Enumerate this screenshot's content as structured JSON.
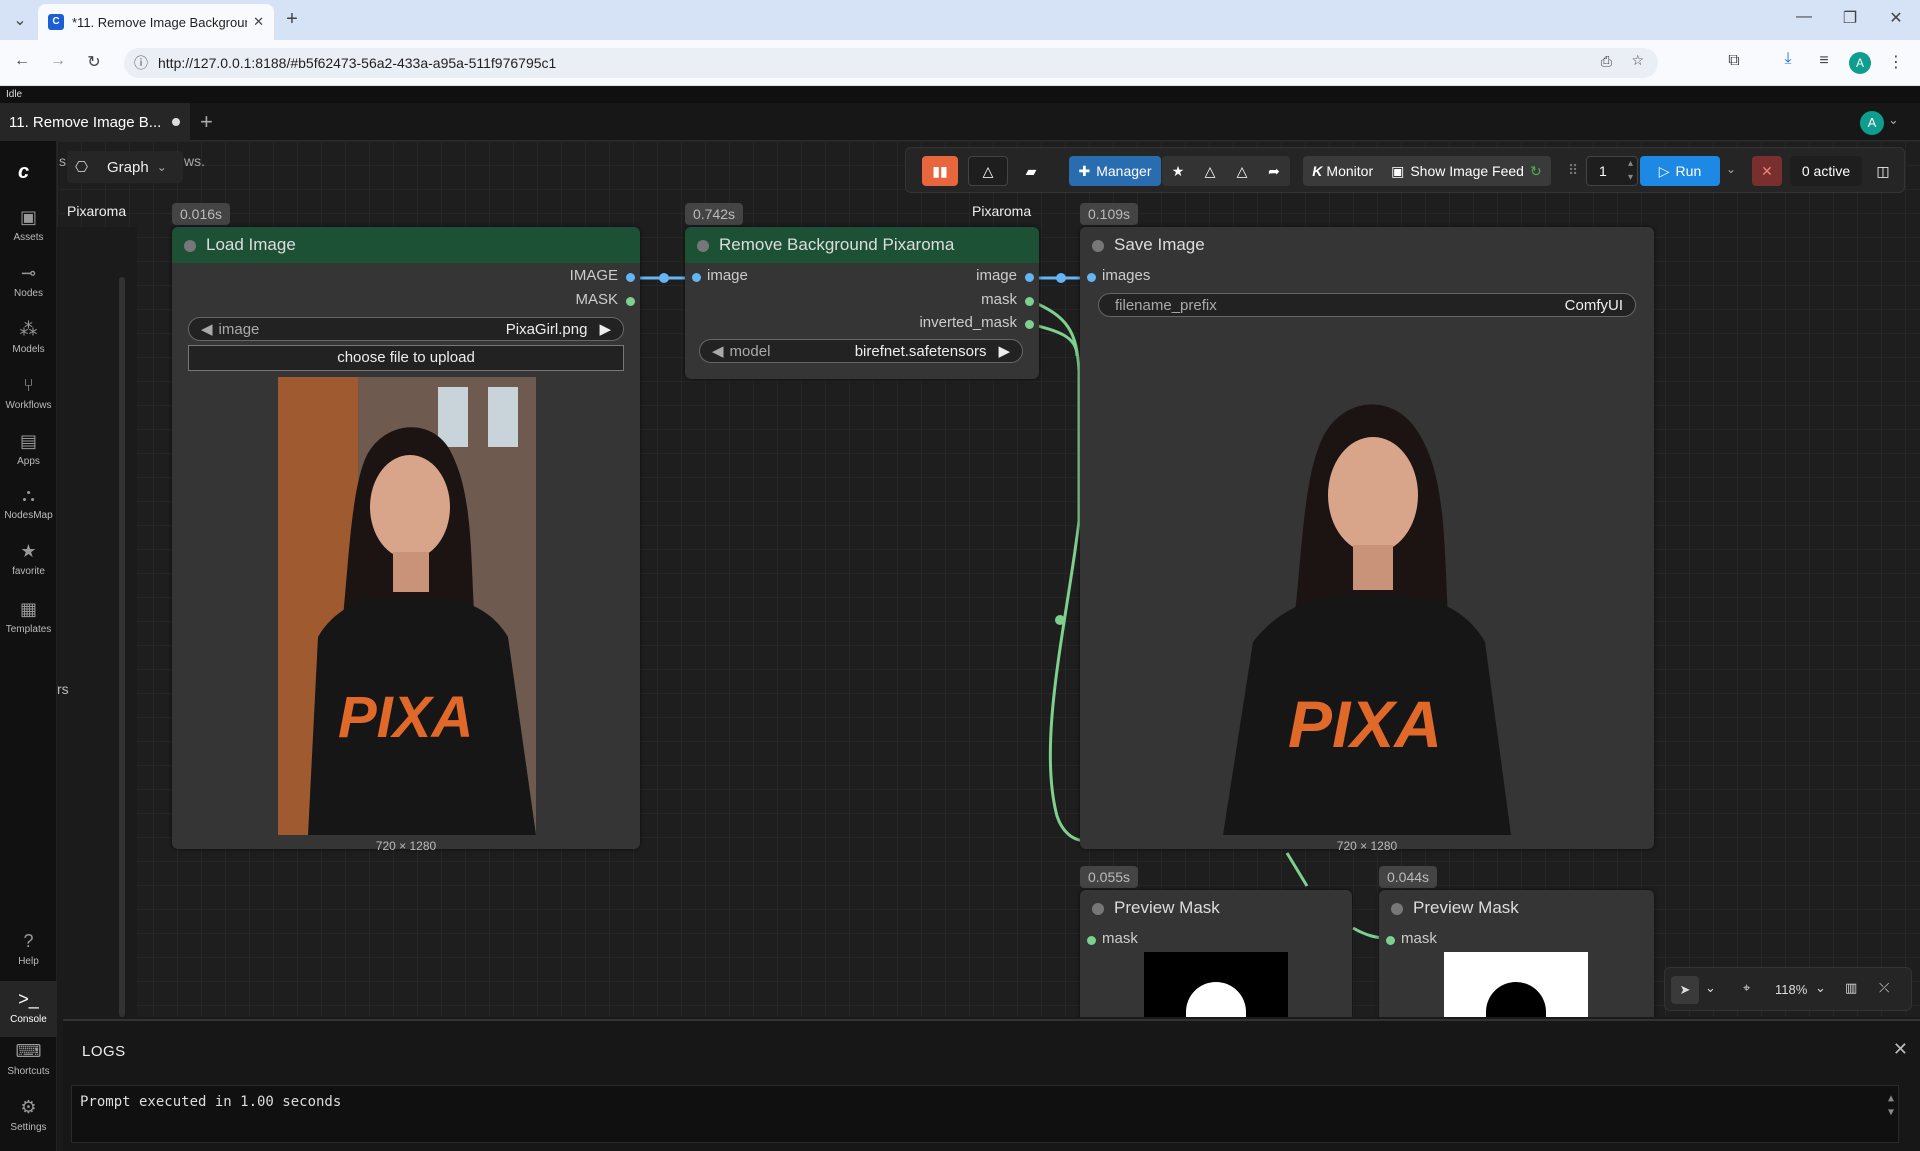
{
  "browser": {
    "tab_title": "*11. Remove Image Backgroun",
    "url": "http://127.0.0.1:8188/#b5f62473-56a2-433a-a95a-511f976795c1",
    "new_tab": "+",
    "profile_initial": "A"
  },
  "app": {
    "status": "Idle",
    "workflow_tab": "11. Remove Image B...",
    "profile_initial": "A",
    "graph_label": "Graph",
    "partial_tab_s": "s",
    "partial_tab_ws": "ws.",
    "partial_text_rs": "rs"
  },
  "sidebar": [
    {
      "label": "Assets",
      "icon": "image-icon"
    },
    {
      "label": "Nodes",
      "icon": "nodes-icon"
    },
    {
      "label": "Models",
      "icon": "cubes-icon"
    },
    {
      "label": "Workflows",
      "icon": "workflow-icon"
    },
    {
      "label": "Apps",
      "icon": "apps-icon"
    },
    {
      "label": "NodesMap",
      "icon": "sitemap-icon"
    },
    {
      "label": "favorite",
      "icon": "star-icon"
    },
    {
      "label": "Templates",
      "icon": "templates-icon"
    },
    {
      "label": "Help",
      "icon": "help-icon"
    },
    {
      "label": "Console",
      "icon": "terminal-icon"
    },
    {
      "label": "Shortcuts",
      "icon": "keyboard-icon"
    },
    {
      "label": "Settings",
      "icon": "gear-icon"
    }
  ],
  "toolbar": {
    "manager": "Manager",
    "monitor": "Monitor",
    "monitor_k": "K",
    "show_image_feed": "Show Image Feed",
    "batch_count": "1",
    "run": "Run",
    "active": "0 active"
  },
  "nodes": {
    "load": {
      "group": "Pixaroma",
      "time": "0.016s",
      "title": "Load Image",
      "out1": "IMAGE",
      "out2": "MASK",
      "widget_label": "image",
      "widget_value": "PixaGirl.png",
      "upload": "choose file to upload",
      "dims": "720 × 1280"
    },
    "remove": {
      "group": "Pixaroma",
      "time": "0.742s",
      "title": "Remove Background Pixaroma",
      "in1": "image",
      "out1": "image",
      "out2": "mask",
      "out3": "inverted_mask",
      "widget_label": "model",
      "widget_value": "birefnet.safetensors"
    },
    "save": {
      "time": "0.109s",
      "title": "Save Image",
      "in1": "images",
      "widget_label": "filename_prefix",
      "widget_value": "ComfyUI",
      "dims": "720 × 1280"
    },
    "preview1": {
      "time": "0.055s",
      "title": "Preview Mask",
      "in1": "mask"
    },
    "preview2": {
      "time": "0.044s",
      "title": "Preview Mask",
      "in1": "mask"
    }
  },
  "zoom": "118%",
  "logs": {
    "header": "LOGS",
    "line": "Prompt executed in 1.00 seconds"
  },
  "colors": {
    "node_header_green": "#1c5136",
    "image_link": "#64b5f6",
    "mask_link": "#7ed08e",
    "run_button": "#1e88e5",
    "orange_button": "#e8663d",
    "manager_button": "#2a6cb0"
  }
}
